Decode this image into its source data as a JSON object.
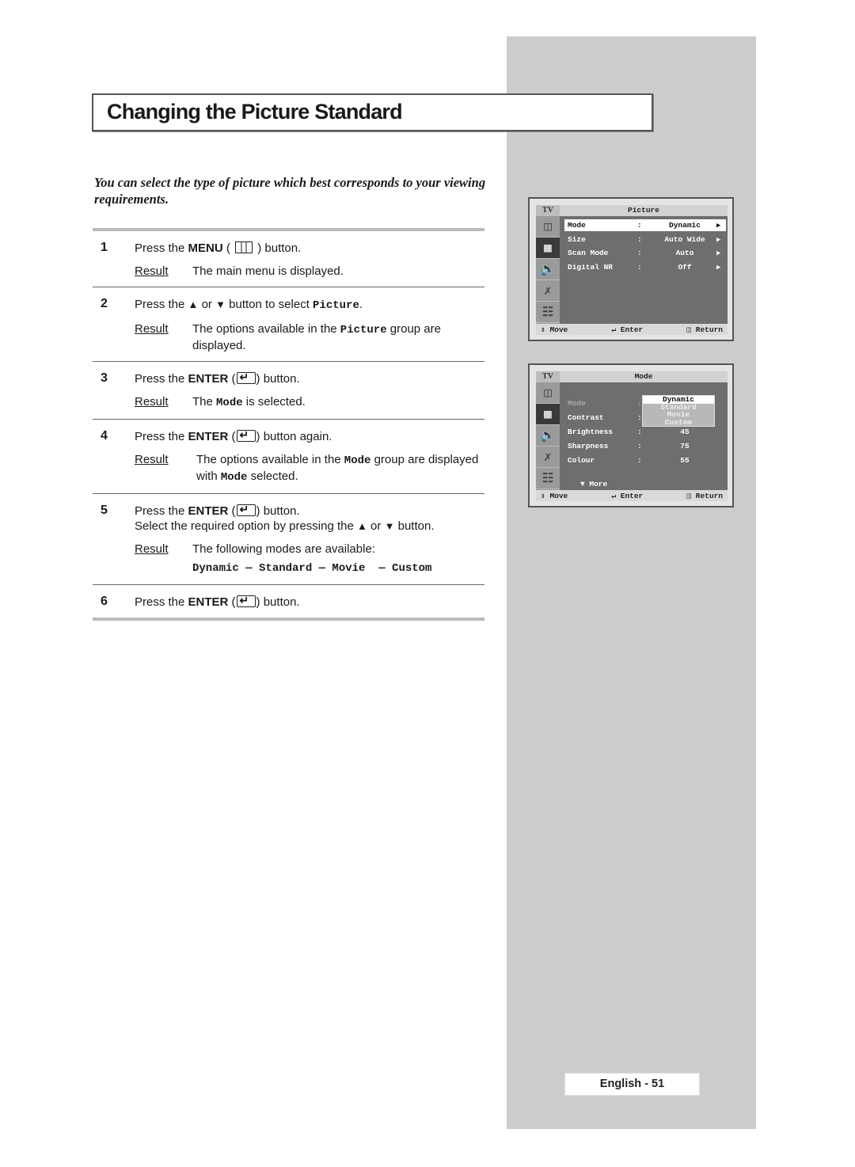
{
  "title": "Changing the Picture Standard",
  "intro": "You can select the type of picture which best corresponds to your viewing requirements.",
  "result_label": "Result",
  "steps": [
    {
      "num": "1",
      "pre": "Press the ",
      "key": "MENU",
      "key_icon": "menu-icon",
      "post": " button.",
      "result": "The main menu is displayed."
    },
    {
      "num": "2",
      "text_a": "Press the ",
      "up": "▲",
      "or": " or ",
      "down": "▼",
      "text_b": " button to select ",
      "code": "Picture",
      "text_c": ".",
      "result_a": "The options available in the ",
      "result_code": "Picture",
      "result_b": " group are displayed."
    },
    {
      "num": "3",
      "pre": "Press the ",
      "key": "ENTER",
      "key_icon": "enter-icon",
      "post": " button.",
      "result_a": "The ",
      "result_code": "Mode",
      "result_b": " is selected."
    },
    {
      "num": "4",
      "pre": "Press the ",
      "key": "ENTER",
      "key_icon": "enter-icon",
      "post": " button again.",
      "result_a": "The options available in the ",
      "result_code": "Mode",
      "result_b": " group are displayed with ",
      "result_code2": "Mode",
      "result_c": " selected."
    },
    {
      "num": "5",
      "pre": "Press the ",
      "key": "ENTER",
      "key_icon": "enter-icon",
      "post": " button.",
      "line2_a": "Select the required option by pressing the ",
      "up": "▲",
      "or": " or ",
      "down": "▼",
      "line2_b": " button.",
      "result": "The following modes are available:",
      "modes": "Dynamic — Standard — Movie  — Custom"
    },
    {
      "num": "6",
      "pre": "Press the ",
      "key": "ENTER",
      "key_icon": "enter-icon",
      "post": " button."
    }
  ],
  "osd1": {
    "tv": "TV",
    "header": "Picture",
    "rows": [
      {
        "label": "Mode",
        "colon": ":",
        "value": "Dynamic",
        "arrow": "▶"
      },
      {
        "label": "Size",
        "colon": ":",
        "value": "Auto Wide",
        "arrow": "▶"
      },
      {
        "label": "Scan Mode",
        "colon": ":",
        "value": "Auto",
        "arrow": "▶"
      },
      {
        "label": "Digital NR",
        "colon": ":",
        "value": "Off",
        "arrow": "▶"
      }
    ],
    "footer": {
      "move": "Move",
      "enter": "Enter",
      "return": "Return"
    }
  },
  "osd2": {
    "tv": "TV",
    "header": "Mode",
    "rows": [
      {
        "label": "Mode",
        "colon": ":",
        "value": ""
      },
      {
        "label": "Contrast",
        "colon": ":",
        "value": ""
      },
      {
        "label": "Brightness",
        "colon": ":",
        "value": "45"
      },
      {
        "label": "Sharpness",
        "colon": ":",
        "value": "75"
      },
      {
        "label": "Colour",
        "colon": ":",
        "value": "55"
      }
    ],
    "dropdown": [
      "Dynamic",
      "Standard",
      "Movie",
      "Custom"
    ],
    "more": "More",
    "footer": {
      "move": "Move",
      "enter": "Enter",
      "return": "Return"
    }
  },
  "page_label": "English - 51"
}
